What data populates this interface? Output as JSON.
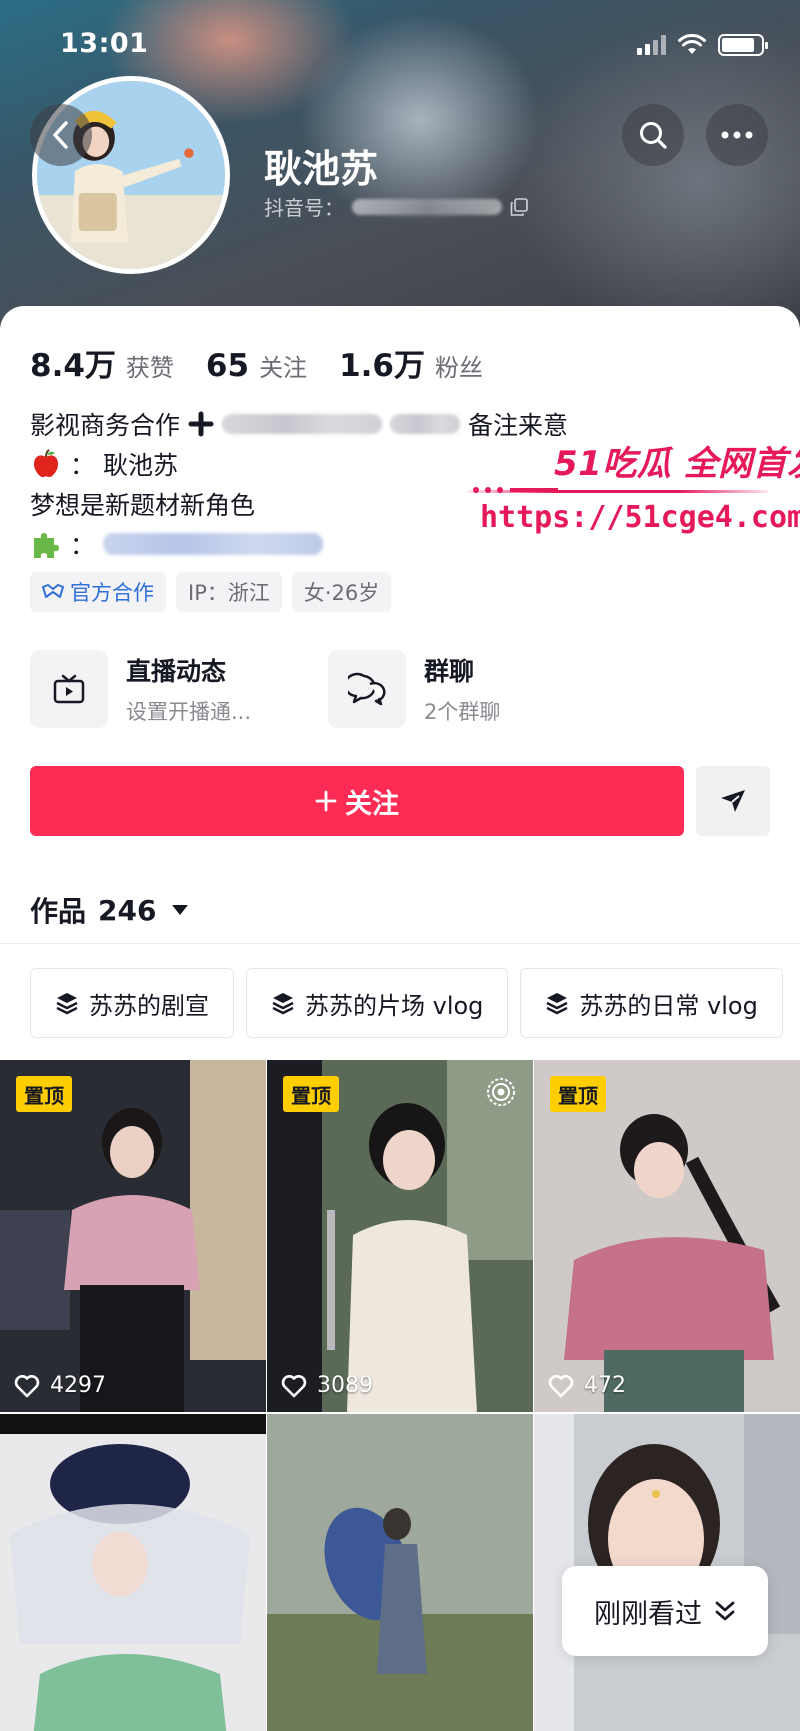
{
  "status_bar": {
    "time": "13:01",
    "battery_level": 0.85
  },
  "header": {
    "name": "耿池苏",
    "id_label": "抖音号："
  },
  "stats": [
    {
      "value": "8.4万",
      "label": "获赞"
    },
    {
      "value": "65",
      "label": "关注"
    },
    {
      "value": "1.6万",
      "label": "粉丝"
    }
  ],
  "bio": {
    "line1_prefix": "影视商务合作",
    "line1_suffix": "备注来意",
    "line2_text": "：  耿池苏",
    "line3_text": "梦想是新题材新角色",
    "line4_text": "："
  },
  "watermark": {
    "title": "51吃瓜 全网首发",
    "url": "https://51cge4.com"
  },
  "tags": [
    {
      "label": "官方合作",
      "icon": "handshake-icon"
    },
    {
      "label": "IP：浙江"
    },
    {
      "label": "女·26岁"
    }
  ],
  "features": [
    {
      "title": "直播动态",
      "subtitle": "设置开播通...",
      "icon": "tv-icon"
    },
    {
      "title": "群聊",
      "subtitle": "2个群聊",
      "icon": "chat-bubbles-icon"
    }
  ],
  "follow_button": {
    "label": "关注"
  },
  "works": {
    "label": "作品",
    "count": "246"
  },
  "collections": [
    {
      "label": "苏苏的剧宣"
    },
    {
      "label": "苏苏的片场 vlog"
    },
    {
      "label": "苏苏的日常 vlog"
    }
  ],
  "videos": [
    {
      "pinned_label": "置顶",
      "likes": "4297"
    },
    {
      "pinned_label": "置顶",
      "likes": "3089",
      "live_icon": "live-ring-icon"
    },
    {
      "pinned_label": "置顶",
      "likes": "472"
    },
    {
      "likes": ""
    },
    {
      "likes": ""
    },
    {
      "likes": ""
    }
  ],
  "recent_button": {
    "label": "刚刚看过"
  },
  "colors": {
    "accent": "#fe2c55",
    "pin": "#fece00",
    "official_blue": "#2e6fd9",
    "watermark": "#e6195a"
  }
}
